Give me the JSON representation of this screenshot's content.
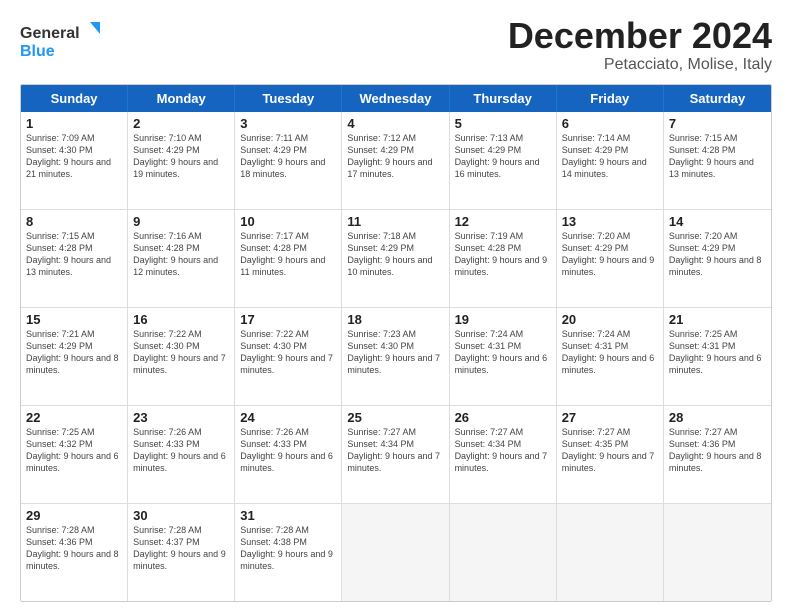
{
  "header": {
    "logo_general": "General",
    "logo_blue": "Blue",
    "month_title": "December 2024",
    "subtitle": "Petacciato, Molise, Italy"
  },
  "days_of_week": [
    "Sunday",
    "Monday",
    "Tuesday",
    "Wednesday",
    "Thursday",
    "Friday",
    "Saturday"
  ],
  "weeks": [
    [
      {
        "day": "1",
        "sunrise": "Sunrise: 7:09 AM",
        "sunset": "Sunset: 4:30 PM",
        "daylight": "Daylight: 9 hours and 21 minutes."
      },
      {
        "day": "2",
        "sunrise": "Sunrise: 7:10 AM",
        "sunset": "Sunset: 4:29 PM",
        "daylight": "Daylight: 9 hours and 19 minutes."
      },
      {
        "day": "3",
        "sunrise": "Sunrise: 7:11 AM",
        "sunset": "Sunset: 4:29 PM",
        "daylight": "Daylight: 9 hours and 18 minutes."
      },
      {
        "day": "4",
        "sunrise": "Sunrise: 7:12 AM",
        "sunset": "Sunset: 4:29 PM",
        "daylight": "Daylight: 9 hours and 17 minutes."
      },
      {
        "day": "5",
        "sunrise": "Sunrise: 7:13 AM",
        "sunset": "Sunset: 4:29 PM",
        "daylight": "Daylight: 9 hours and 16 minutes."
      },
      {
        "day": "6",
        "sunrise": "Sunrise: 7:14 AM",
        "sunset": "Sunset: 4:29 PM",
        "daylight": "Daylight: 9 hours and 14 minutes."
      },
      {
        "day": "7",
        "sunrise": "Sunrise: 7:15 AM",
        "sunset": "Sunset: 4:28 PM",
        "daylight": "Daylight: 9 hours and 13 minutes."
      }
    ],
    [
      {
        "day": "8",
        "sunrise": "Sunrise: 7:15 AM",
        "sunset": "Sunset: 4:28 PM",
        "daylight": "Daylight: 9 hours and 13 minutes."
      },
      {
        "day": "9",
        "sunrise": "Sunrise: 7:16 AM",
        "sunset": "Sunset: 4:28 PM",
        "daylight": "Daylight: 9 hours and 12 minutes."
      },
      {
        "day": "10",
        "sunrise": "Sunrise: 7:17 AM",
        "sunset": "Sunset: 4:28 PM",
        "daylight": "Daylight: 9 hours and 11 minutes."
      },
      {
        "day": "11",
        "sunrise": "Sunrise: 7:18 AM",
        "sunset": "Sunset: 4:29 PM",
        "daylight": "Daylight: 9 hours and 10 minutes."
      },
      {
        "day": "12",
        "sunrise": "Sunrise: 7:19 AM",
        "sunset": "Sunset: 4:28 PM",
        "daylight": "Daylight: 9 hours and 9 minutes."
      },
      {
        "day": "13",
        "sunrise": "Sunrise: 7:20 AM",
        "sunset": "Sunset: 4:29 PM",
        "daylight": "Daylight: 9 hours and 9 minutes."
      },
      {
        "day": "14",
        "sunrise": "Sunrise: 7:20 AM",
        "sunset": "Sunset: 4:29 PM",
        "daylight": "Daylight: 9 hours and 8 minutes."
      }
    ],
    [
      {
        "day": "15",
        "sunrise": "Sunrise: 7:21 AM",
        "sunset": "Sunset: 4:29 PM",
        "daylight": "Daylight: 9 hours and 8 minutes."
      },
      {
        "day": "16",
        "sunrise": "Sunrise: 7:22 AM",
        "sunset": "Sunset: 4:30 PM",
        "daylight": "Daylight: 9 hours and 7 minutes."
      },
      {
        "day": "17",
        "sunrise": "Sunrise: 7:22 AM",
        "sunset": "Sunset: 4:30 PM",
        "daylight": "Daylight: 9 hours and 7 minutes."
      },
      {
        "day": "18",
        "sunrise": "Sunrise: 7:23 AM",
        "sunset": "Sunset: 4:30 PM",
        "daylight": "Daylight: 9 hours and 7 minutes."
      },
      {
        "day": "19",
        "sunrise": "Sunrise: 7:24 AM",
        "sunset": "Sunset: 4:31 PM",
        "daylight": "Daylight: 9 hours and 6 minutes."
      },
      {
        "day": "20",
        "sunrise": "Sunrise: 7:24 AM",
        "sunset": "Sunset: 4:31 PM",
        "daylight": "Daylight: 9 hours and 6 minutes."
      },
      {
        "day": "21",
        "sunrise": "Sunrise: 7:25 AM",
        "sunset": "Sunset: 4:31 PM",
        "daylight": "Daylight: 9 hours and 6 minutes."
      }
    ],
    [
      {
        "day": "22",
        "sunrise": "Sunrise: 7:25 AM",
        "sunset": "Sunset: 4:32 PM",
        "daylight": "Daylight: 9 hours and 6 minutes."
      },
      {
        "day": "23",
        "sunrise": "Sunrise: 7:26 AM",
        "sunset": "Sunset: 4:33 PM",
        "daylight": "Daylight: 9 hours and 6 minutes."
      },
      {
        "day": "24",
        "sunrise": "Sunrise: 7:26 AM",
        "sunset": "Sunset: 4:33 PM",
        "daylight": "Daylight: 9 hours and 6 minutes."
      },
      {
        "day": "25",
        "sunrise": "Sunrise: 7:27 AM",
        "sunset": "Sunset: 4:34 PM",
        "daylight": "Daylight: 9 hours and 7 minutes."
      },
      {
        "day": "26",
        "sunrise": "Sunrise: 7:27 AM",
        "sunset": "Sunset: 4:34 PM",
        "daylight": "Daylight: 9 hours and 7 minutes."
      },
      {
        "day": "27",
        "sunrise": "Sunrise: 7:27 AM",
        "sunset": "Sunset: 4:35 PM",
        "daylight": "Daylight: 9 hours and 7 minutes."
      },
      {
        "day": "28",
        "sunrise": "Sunrise: 7:27 AM",
        "sunset": "Sunset: 4:36 PM",
        "daylight": "Daylight: 9 hours and 8 minutes."
      }
    ],
    [
      {
        "day": "29",
        "sunrise": "Sunrise: 7:28 AM",
        "sunset": "Sunset: 4:36 PM",
        "daylight": "Daylight: 9 hours and 8 minutes."
      },
      {
        "day": "30",
        "sunrise": "Sunrise: 7:28 AM",
        "sunset": "Sunset: 4:37 PM",
        "daylight": "Daylight: 9 hours and 9 minutes."
      },
      {
        "day": "31",
        "sunrise": "Sunrise: 7:28 AM",
        "sunset": "Sunset: 4:38 PM",
        "daylight": "Daylight: 9 hours and 9 minutes."
      },
      null,
      null,
      null,
      null
    ]
  ]
}
